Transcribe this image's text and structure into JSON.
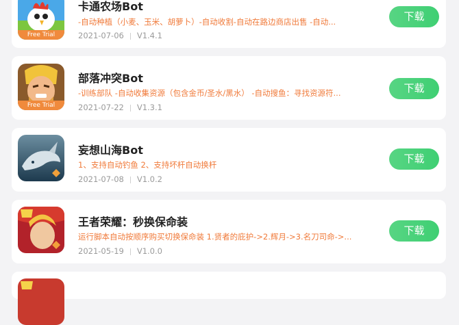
{
  "apps": [
    {
      "title": "卡通农场Bot",
      "description": "-自动种植（小麦、玉米、胡萝卜）-自动收割-自动在路边商店出售 -自动...",
      "date": "2021-07-06",
      "version": "V1.4.1",
      "badge": "Free Trial",
      "icon": "hayday-rooster-icon",
      "button": "下载"
    },
    {
      "title": "部落冲突Bot",
      "description": "-训练部队 -自动收集资源（包含金币/圣水/黑水） -自动搜鱼：寻找资源符...",
      "date": "2021-07-22",
      "version": "V1.3.1",
      "badge": "Free Trial",
      "icon": "clash-of-clans-barbarian-icon",
      "button": "下载"
    },
    {
      "title": "妄想山海Bot",
      "description": "1、支持自动钓鱼 2、支持坏杆自动换杆",
      "date": "2021-07-08",
      "version": "V1.0.2",
      "icon": "sea-whale-icon",
      "button": "下载"
    },
    {
      "title": "王者荣耀：秒换保命装",
      "description": "运行脚本自动按顺序购买切换保命装 1.贤者的庇护->2.辉月->3.名刀司命->...",
      "date": "2021-05-19",
      "version": "V1.0.0",
      "icon": "honor-of-kings-hero-icon",
      "button": "下载"
    }
  ],
  "colors": {
    "accent_green": "#4cd27a",
    "description_orange": "#f07a3a",
    "badge_orange": "#f08a3c"
  }
}
